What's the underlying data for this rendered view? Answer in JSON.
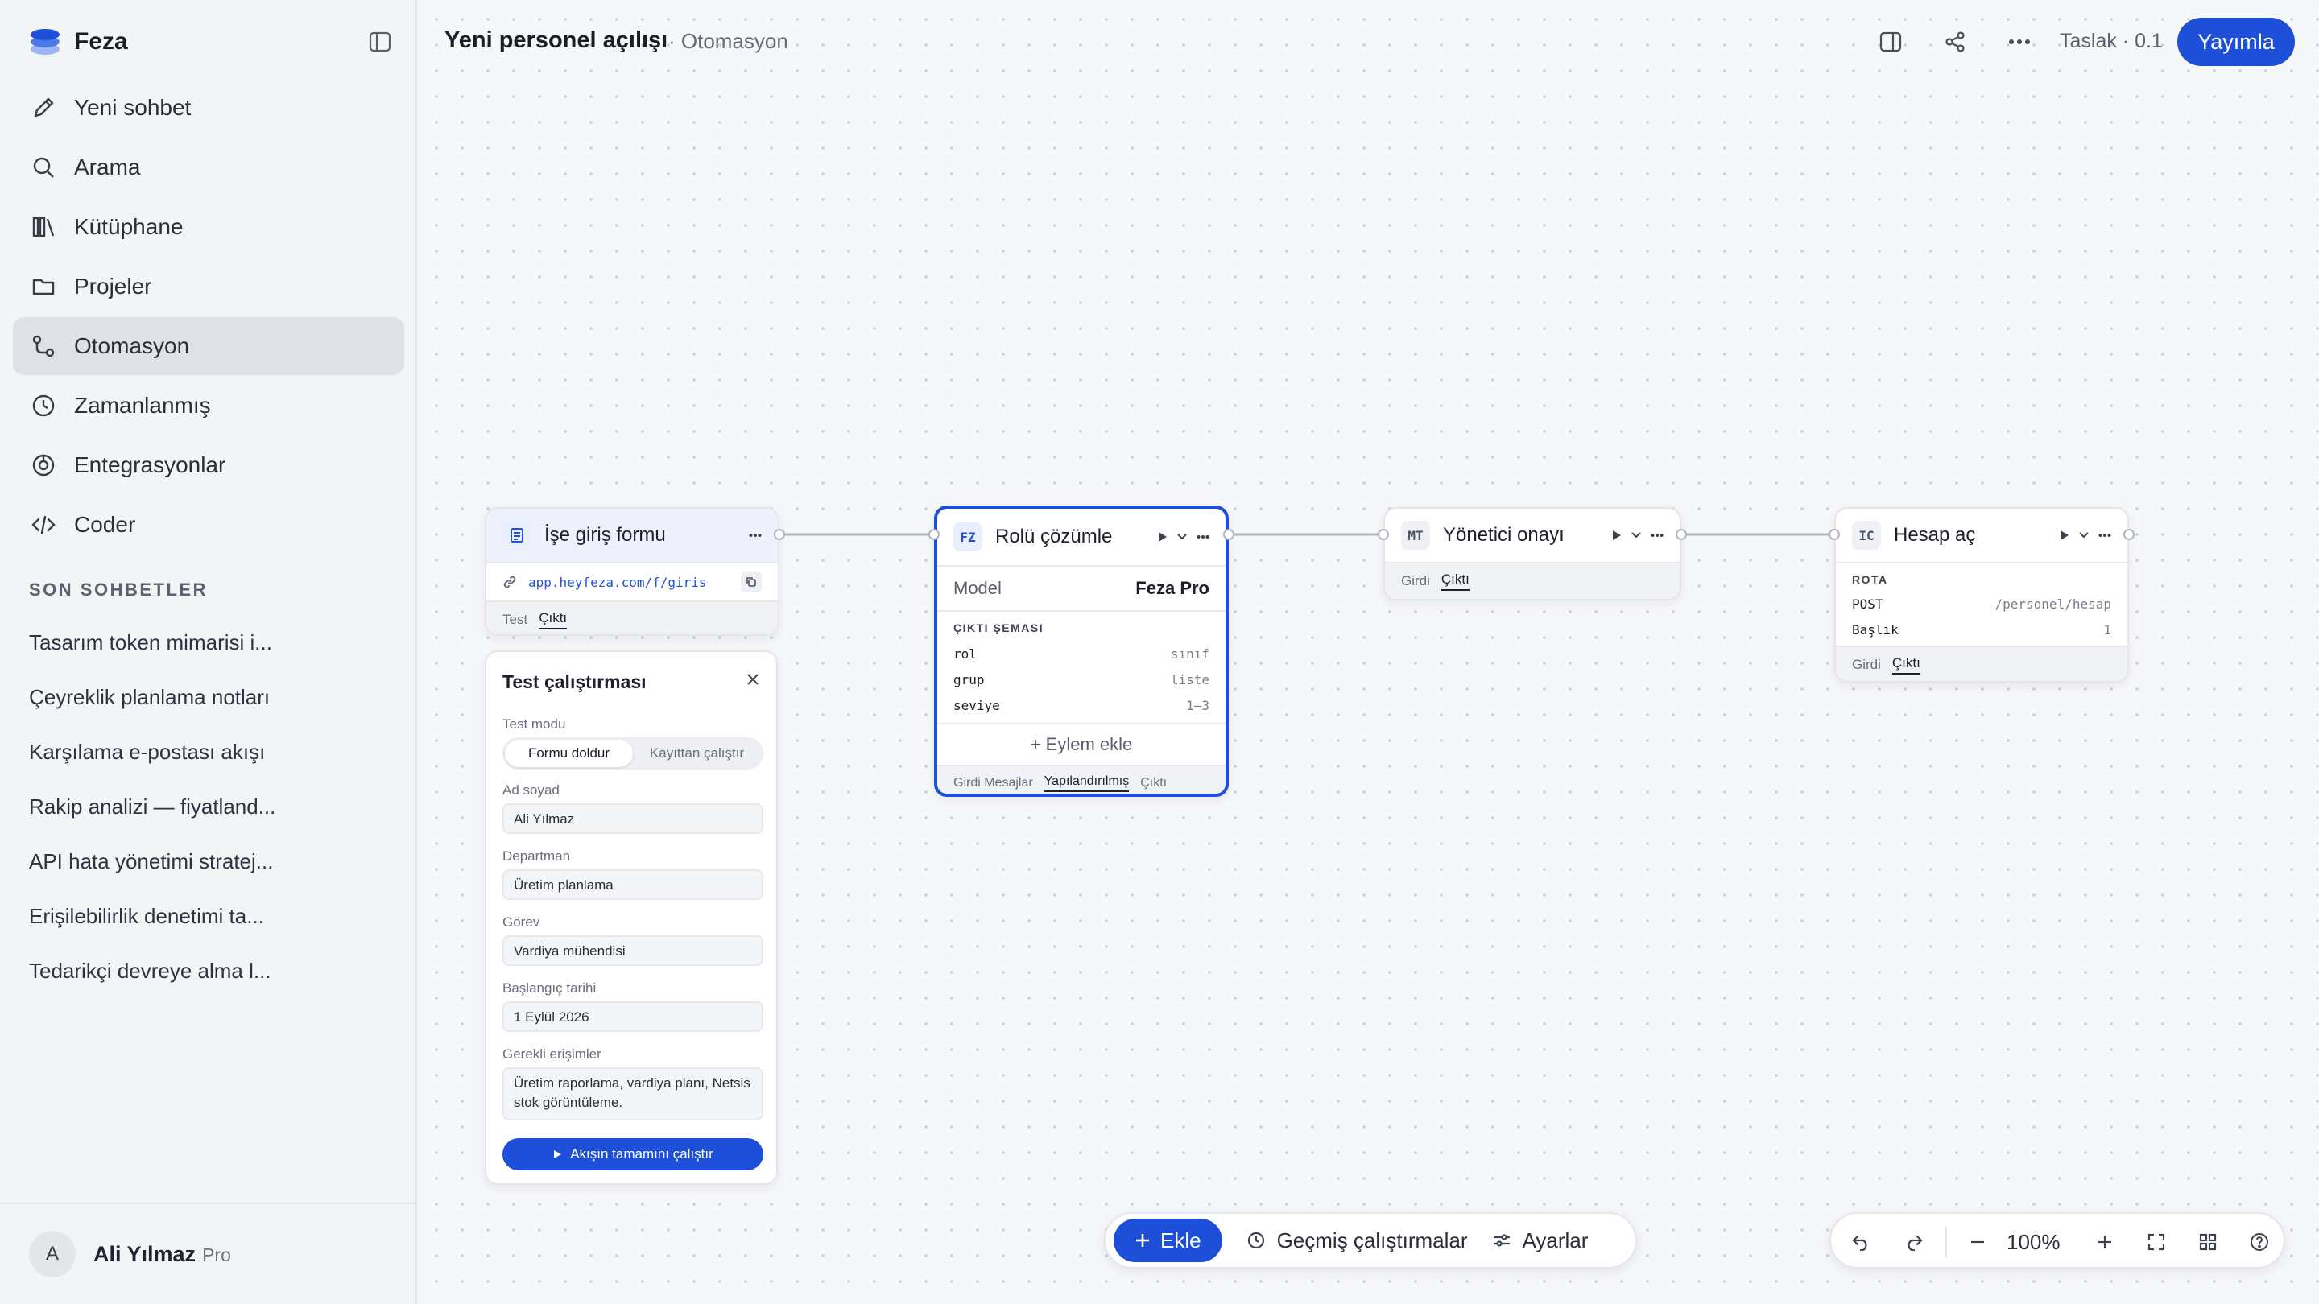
{
  "app": {
    "name": "Feza"
  },
  "sidebar": {
    "nav": [
      {
        "label": "Yeni sohbet",
        "icon": "pencil-icon"
      },
      {
        "label": "Arama",
        "icon": "search-icon"
      },
      {
        "label": "Kütüphane",
        "icon": "library-icon"
      },
      {
        "label": "Projeler",
        "icon": "folder-icon"
      },
      {
        "label": "Otomasyon",
        "icon": "workflow-icon",
        "active": true
      },
      {
        "label": "Zamanlanmış",
        "icon": "clock-icon"
      },
      {
        "label": "Entegrasyonlar",
        "icon": "integration-icon"
      },
      {
        "label": "Coder",
        "icon": "code-icon"
      }
    ],
    "recent_title": "SON SOHBETLER",
    "recent": [
      "Tasarım token mimarisi i...",
      "Çeyreklik planlama notları",
      "Karşılama e-postası akışı",
      "Rakip analizi — fiyatland...",
      "API hata yönetimi stratej...",
      "Erişilebilirlik denetimi ta...",
      "Tedarikçi devreye alma l..."
    ],
    "user": {
      "initial": "A",
      "name": "Ali Yılmaz",
      "plan": "Pro"
    }
  },
  "header": {
    "title": "Yeni personel açılışı",
    "breadcrumb": "· Otomasyon",
    "version": "Taslak · 0.1",
    "publish_label": "Yayımla"
  },
  "nodes": {
    "form": {
      "title": "İşe giriş formu",
      "url": "app.heyfeza.com/f/giris",
      "tabs": [
        "Test",
        "Çıktı"
      ]
    },
    "role": {
      "badge": "FZ",
      "title": "Rolü çözümle",
      "model_label": "Model",
      "model_value": "Feza Pro",
      "schema_title": "ÇIKTI ŞEMASI",
      "schema": [
        {
          "key": "rol",
          "type": "sınıf"
        },
        {
          "key": "grup",
          "type": "liste"
        },
        {
          "key": "seviye",
          "type": "1–3"
        }
      ],
      "add_action": "+ Eylem ekle",
      "tabs": [
        "Girdi Mesajlar",
        "Yapılandırılmış",
        "Çıktı"
      ]
    },
    "approval": {
      "badge": "MT",
      "title": "Yönetici onayı",
      "tabs": [
        "Girdi",
        "Çıktı"
      ]
    },
    "account": {
      "badge": "IC",
      "title": "Hesap aç",
      "route_title": "ROTA",
      "method": "POST",
      "path": "/personel/hesap",
      "header_label": "Başlık",
      "header_count": "1",
      "tabs": [
        "Girdi",
        "Çıktı"
      ]
    }
  },
  "test_panel": {
    "title": "Test çalıştırması",
    "mode_label": "Test modu",
    "modes": [
      "Formu doldur",
      "Kayıttan çalıştır"
    ],
    "fields": [
      {
        "label": "Ad soyad",
        "value": "Ali Yılmaz"
      },
      {
        "label": "Departman",
        "value": "Üretim planlama"
      },
      {
        "label": "Görev",
        "value": "Vardiya mühendisi"
      },
      {
        "label": "Başlangıç tarihi",
        "value": "1 Eylül 2026"
      },
      {
        "label": "Gerekli erişimler",
        "value": "Üretim raporlama, vardiya planı, Netsis stok görüntüleme."
      }
    ],
    "run_label": "Akışın tamamını çalıştır"
  },
  "bottom_bar": {
    "add_label": "Ekle",
    "history_label": "Geçmiş çalıştırmalar",
    "settings_label": "Ayarlar"
  },
  "zoom": {
    "level": "100%"
  },
  "colors": {
    "accent": "#1d4fd8",
    "sidebar_bg": "#f3f4f6",
    "canvas_bg": "#f6f7f9"
  }
}
